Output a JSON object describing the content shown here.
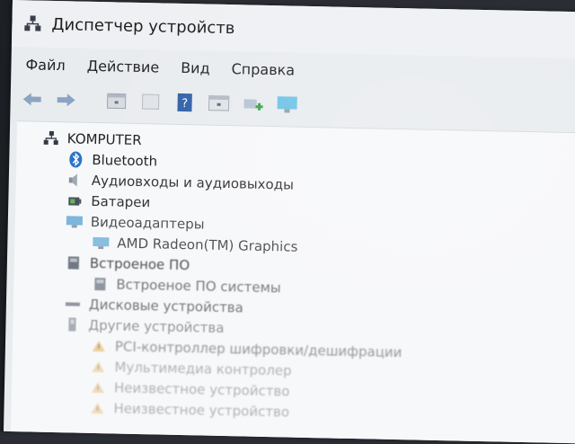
{
  "window": {
    "title": "Диспетчер устройств"
  },
  "menu": [
    "Файл",
    "Действие",
    "Вид",
    "Справка"
  ],
  "toolbar": [
    "back-icon",
    "forward-icon",
    "properties-icon",
    "update-driver-icon",
    "help-icon",
    "view-icon",
    "scan-hardware-icon",
    "monitor-icon"
  ],
  "tree": {
    "root": "KOMPUTER",
    "items": [
      {
        "label": "Bluetooth",
        "icon": "bluetooth-icon"
      },
      {
        "label": "Аудиовходы и аудиовыходы",
        "icon": "audio-icon"
      },
      {
        "label": "Батареи",
        "icon": "battery-icon"
      },
      {
        "label": "Видеоадаптеры",
        "icon": "display-adapter-icon"
      },
      {
        "label": "AMD Radeon(TM) Graphics",
        "icon": "gpu-icon",
        "child": true
      },
      {
        "label": "Встроеное ПО",
        "icon": "firmware-icon"
      },
      {
        "label": "Встроеное ПО системы",
        "icon": "firmware-icon",
        "child": true
      },
      {
        "label": "Дисковые устройства",
        "icon": "disk-icon"
      },
      {
        "label": "Другие устройства",
        "icon": "other-devices-icon"
      },
      {
        "label": "PCI-контроллер шифровки/дешифрации",
        "icon": "warning-icon",
        "child": true
      },
      {
        "label": "Мультимедиа контролер",
        "icon": "warning-icon",
        "child": true
      },
      {
        "label": "Неизвестное устройство",
        "icon": "warning-icon",
        "child": true
      },
      {
        "label": "Неизвестное устройство",
        "icon": "warning-icon",
        "child": true
      }
    ]
  },
  "colors": {
    "accent": "#1a73c9",
    "warning": "#d08a10"
  }
}
